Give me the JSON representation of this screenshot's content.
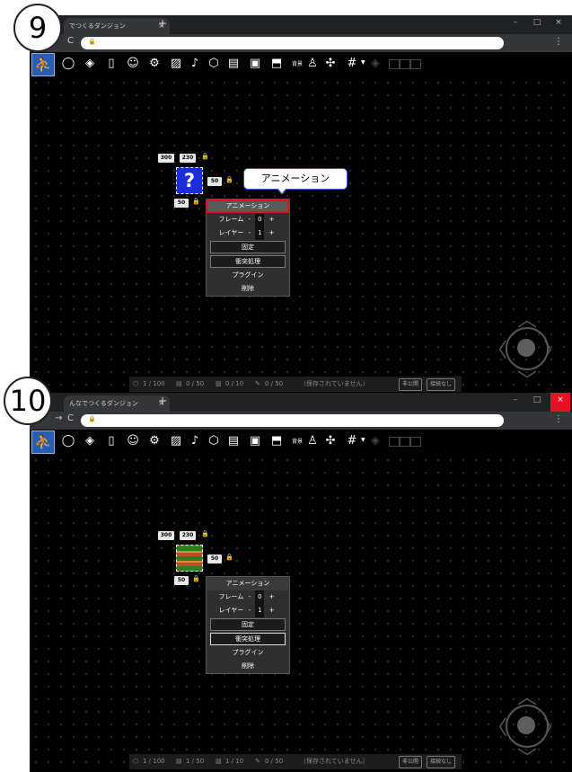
{
  "steps": [
    "9",
    "10"
  ],
  "browser": {
    "tab_title_1": "でつくるダンジョン",
    "tab_title_2": "んなでつくるダンジョン",
    "tab_close": "×",
    "new_tab": "+",
    "minimize": "–",
    "maximize": "□",
    "close": "×",
    "back": "→",
    "reload": "C",
    "lock": "🔒",
    "menu": "⋮"
  },
  "toolbar": {
    "text_label": "背景",
    "dropdown": "▼"
  },
  "canvas": {
    "pos_x": "300",
    "pos_y": "230",
    "width": "50",
    "height": "50",
    "unknown_tile": "?"
  },
  "menu": {
    "animation": "アニメーション",
    "frame_label": "フレーム",
    "frame_value": "0",
    "layer_label": "レイヤー",
    "layer_value": "1",
    "minus": "-",
    "plus": "+",
    "fix": "固定",
    "collision": "衝突処理",
    "plugin": "プラグイン",
    "delete": "削除"
  },
  "callout": "アニメーション",
  "status_1": {
    "objects": "1 / 100",
    "frames": "0 / 50",
    "images": "0 / 10",
    "scripts": "0 / 50",
    "save_state": "（保存されていません）",
    "private_btn": "非公開",
    "connection_btn": "接続なし"
  },
  "status_2": {
    "objects": "1 / 100",
    "frames": "1 / 50",
    "images": "1 / 10",
    "scripts": "0 / 50",
    "save_state": "（保存されていません）",
    "private_btn": "非公開",
    "connection_btn": "接続なし"
  }
}
